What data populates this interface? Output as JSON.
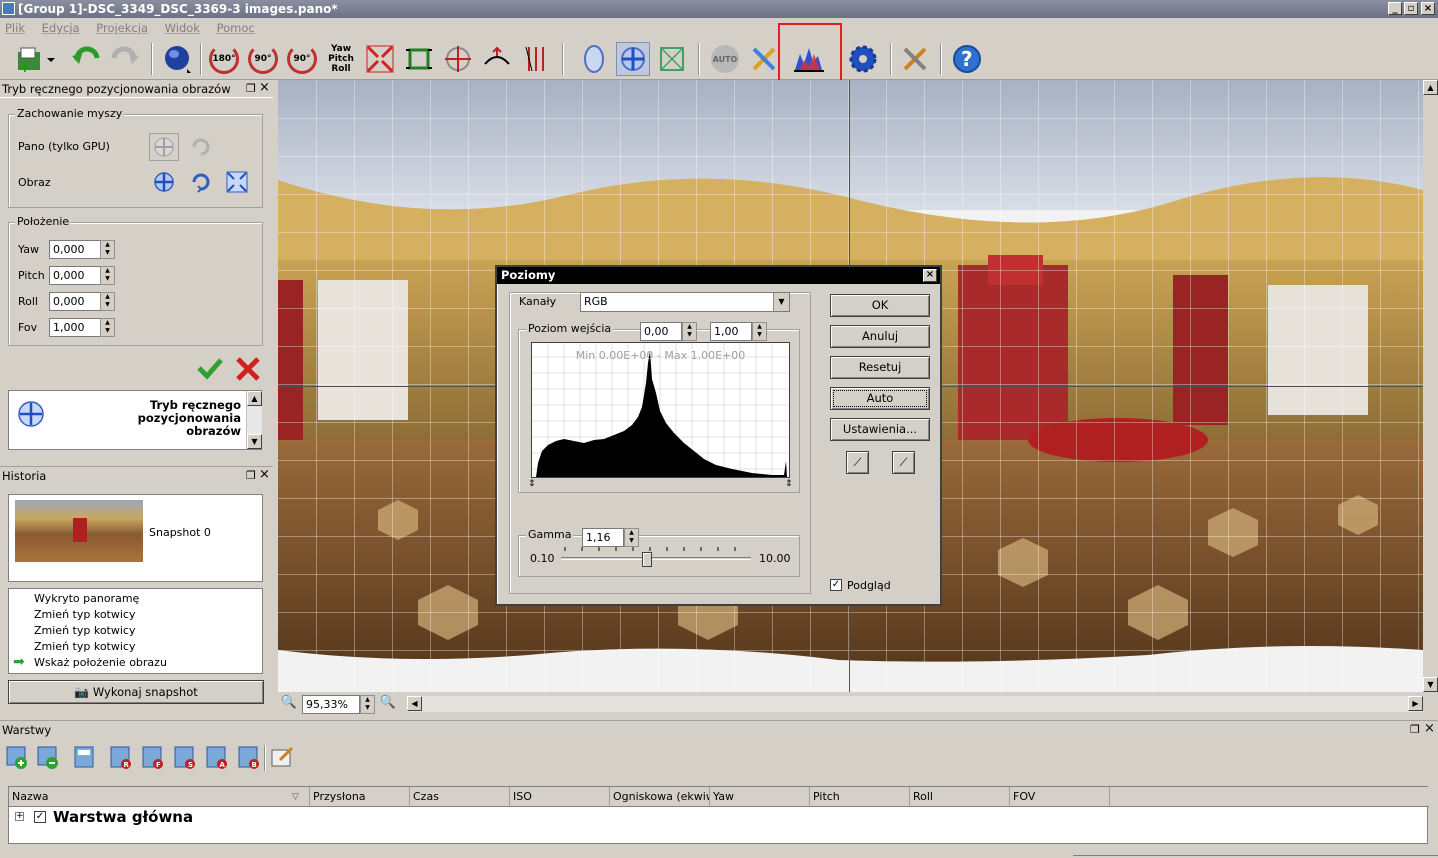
{
  "window": {
    "title": "[Group 1]-DSC_3349_DSC_3369-3 images.pano*"
  },
  "menu": {
    "items": [
      "Plik",
      "Edycja",
      "Projekcja",
      "Widok",
      "Pomoc"
    ]
  },
  "toolbar": {
    "rot180": "180°",
    "rot90cw": "90°",
    "rot90ccw": "90°",
    "ypr_line1": "Yaw",
    "ypr_line2": "Pitch",
    "ypr_line3": "Roll",
    "auto": "AUTO"
  },
  "left_panel": {
    "title": "Tryb ręcznego pozycjonowania obrazów",
    "mouse_group": "Zachowanie myszy",
    "pano_label": "Pano (tylko GPU)",
    "image_label": "Obraz",
    "position_group": "Położenie",
    "fields": [
      {
        "label": "Yaw",
        "value": "0,000"
      },
      {
        "label": "Pitch",
        "value": "0,000"
      },
      {
        "label": "Roll",
        "value": "0,000"
      },
      {
        "label": "Fov",
        "value": "1,000"
      }
    ],
    "info_text": "Tryb ręcznego pozycjonowania obrazów"
  },
  "history": {
    "title": "Historia",
    "snapshot_label": "Snapshot 0",
    "items": [
      "Wykryto panoramę",
      "Zmień typ kotwicy",
      "Zmień typ kotwicy",
      "Zmień typ kotwicy",
      "Wskaż położenie obrazu"
    ],
    "snapshot_button": "Wykonaj snapshot"
  },
  "zoom": {
    "value": "95,33%"
  },
  "dialog": {
    "title": "Poziomy",
    "channels_label": "Kanały",
    "channel_value": "RGB",
    "input_level_label": "Poziom wejścia",
    "input_min": "0,00",
    "input_max": "1,00",
    "histogram_caption": "Min 0.00E+00 - Max 1.00E+00",
    "gamma_label": "Gamma",
    "gamma_value": "1,16",
    "gamma_min": "0.10",
    "gamma_max": "10.00",
    "gamma_level": 0.45,
    "buttons": {
      "ok": "OK",
      "cancel": "Anuluj",
      "reset": "Resetuj",
      "auto": "Auto",
      "settings": "Ustawienia..."
    },
    "preview_label": "Podgląd",
    "preview_checked": true
  },
  "layers": {
    "title": "Warstwy",
    "columns": [
      "Nazwa",
      "Przysłona",
      "Czas",
      "ISO",
      "Ogniskowa (ekwiwa",
      "Yaw",
      "Pitch",
      "Roll",
      "FOV"
    ],
    "rows": [
      {
        "name": "Warstwa główna",
        "checked": true
      }
    ]
  }
}
